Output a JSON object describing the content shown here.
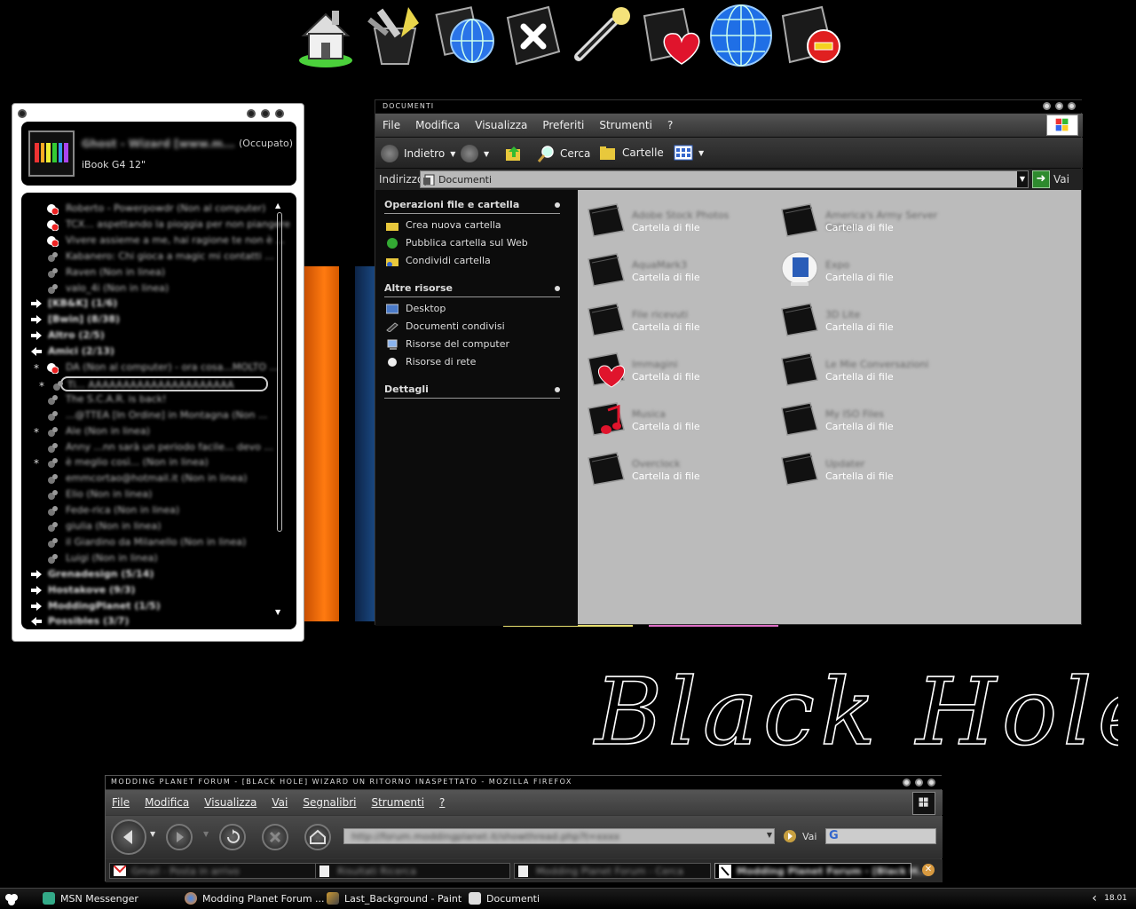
{
  "dock": {
    "icons": [
      "home-icon",
      "tools-icon",
      "web-tools-icon",
      "close-folder-icon",
      "pen-icon",
      "favorites-folder-icon",
      "globe-icon",
      "remove-folder-icon"
    ]
  },
  "wallpaper": {
    "text": "Black Hole"
  },
  "msn": {
    "display_name": "Ghost - Wizard [www.m...",
    "status": "(Occupato)",
    "personal_message": "iBook G4 12\"",
    "contacts": [
      {
        "text": "Roberto - Powerpowdr (Non al computer)",
        "icon": "busy",
        "indent": 1
      },
      {
        "text": "TCX... aspettando la pioggia per non piangere",
        "icon": "busy",
        "indent": 1
      },
      {
        "text": "Vivere assieme a me, hai ragione te non è ...",
        "icon": "busy",
        "indent": 1
      },
      {
        "text": "Kabanero: Chi gioca a magic mi contatti ...",
        "icon": "offline",
        "indent": 1
      },
      {
        "text": "Raven (Non in linea)",
        "icon": "offline",
        "indent": 1
      },
      {
        "text": "valo_4i (Non in linea)",
        "icon": "offline",
        "indent": 1
      },
      {
        "text": "[KB&K] (1/6)",
        "icon": "arrow-right",
        "indent": 0,
        "group": true
      },
      {
        "text": "[Bwin] (8/38)",
        "icon": "arrow-right",
        "indent": 0,
        "group": true
      },
      {
        "text": "Altro (2/5)",
        "icon": "arrow-right",
        "indent": 0,
        "group": true
      },
      {
        "text": "Amici (2/13)",
        "icon": "arrow-left",
        "indent": 0,
        "group": true
      },
      {
        "text": "DA (Non al computer) - ora cosa...MOLTO ...",
        "icon": "busy",
        "indent": 1,
        "star": true
      },
      {
        "text": "Ti... AAAAAAAAAAAAAAAAAAAAA",
        "icon": "offline",
        "indent": 1,
        "star": true,
        "selected": true
      },
      {
        "text": "The S.C.A.R. is back!",
        "icon": "offline",
        "indent": 1
      },
      {
        "text": "...@TTEA [In Ordine] in Montagna (Non ...",
        "icon": "offline",
        "indent": 1
      },
      {
        "text": "Ale (Non in linea)",
        "icon": "offline",
        "indent": 1,
        "star": true
      },
      {
        "text": "Anny ...nn sarà un periodo facile... devo ...",
        "icon": "offline",
        "indent": 1
      },
      {
        "text": "è meglio così... (Non in linea)",
        "icon": "offline",
        "indent": 1,
        "star": true
      },
      {
        "text": "emmcortao@hotmail.it (Non in linea)",
        "icon": "offline",
        "indent": 1
      },
      {
        "text": "Elio (Non in linea)",
        "icon": "offline",
        "indent": 1
      },
      {
        "text": "Fede-rica (Non in linea)",
        "icon": "offline",
        "indent": 1
      },
      {
        "text": "giulia (Non in linea)",
        "icon": "offline",
        "indent": 1
      },
      {
        "text": "il Giardino da Milanello (Non in linea)",
        "icon": "offline",
        "indent": 1
      },
      {
        "text": "Luigi (Non in linea)",
        "icon": "offline",
        "indent": 1
      },
      {
        "text": "Grenadesign (5/14)",
        "icon": "arrow-right",
        "indent": 0,
        "group": true
      },
      {
        "text": "Hostakove (9/3)",
        "icon": "arrow-right",
        "indent": 0,
        "group": true
      },
      {
        "text": "ModdingPlanet (1/5)",
        "icon": "arrow-right",
        "indent": 0,
        "group": true
      },
      {
        "text": "Possibles (3/7)",
        "icon": "arrow-left",
        "indent": 0,
        "group": true
      }
    ]
  },
  "explorer": {
    "title": "Documenti",
    "menu": [
      "File",
      "Modifica",
      "Visualizza",
      "Preferiti",
      "Strumenti",
      "?"
    ],
    "toolbar": {
      "back": "Indietro",
      "search": "Cerca",
      "folders": "Cartelle"
    },
    "address": {
      "label": "Indirizzo",
      "value": "Documenti",
      "go": "Vai"
    },
    "sidebar": {
      "tasks_title": "Operazioni file e cartella",
      "tasks": [
        "Crea nuova cartella",
        "Pubblica cartella sul Web",
        "Condividi cartella"
      ],
      "places_title": "Altre risorse",
      "places": [
        "Desktop",
        "Documenti condivisi",
        "Risorse del computer",
        "Risorse di rete"
      ],
      "details_title": "Dettagli"
    },
    "files": [
      {
        "name": "Adobe Stock Photos",
        "type": "Cartella di file",
        "icon": "folder"
      },
      {
        "name": "America's Army Server Setups",
        "type": "Cartella di file",
        "icon": "folder"
      },
      {
        "name": "AquaMark3",
        "type": "Cartella di file",
        "icon": "folder"
      },
      {
        "name": "Expo",
        "type": "Cartella di file",
        "icon": "imac"
      },
      {
        "name": "File ricevuti",
        "type": "Cartella di file",
        "icon": "folder"
      },
      {
        "name": "3D Lite",
        "type": "Cartella di file",
        "icon": "folder"
      },
      {
        "name": "Immagini",
        "type": "Cartella di file",
        "icon": "heart"
      },
      {
        "name": "Le Mie Conversazioni",
        "type": "Cartella di file",
        "icon": "folder"
      },
      {
        "name": "Musica",
        "type": "Cartella di file",
        "icon": "music"
      },
      {
        "name": "My ISO Files",
        "type": "Cartella di file",
        "icon": "folder"
      },
      {
        "name": "Overclock",
        "type": "Cartella di file",
        "icon": "folder"
      },
      {
        "name": "Updater",
        "type": "Cartella di file",
        "icon": "folder"
      }
    ]
  },
  "firefox": {
    "title": "Modding Planet Forum - [Black Hole] Wizard Un Ritorno Inaspettato - Mozilla Firefox",
    "menu": [
      "File",
      "Modifica",
      "Visualizza",
      "Vai",
      "Segnalibri",
      "Strumenti",
      "?"
    ],
    "url": "http://forum.moddingplanet.it/showthread.php?t=xxxx",
    "go": "Vai",
    "tabs": [
      "Gmail - Posta in arrivo",
      "Risultati Ricerca",
      "Modding Planet Forum - Cerca",
      "Modding Planet Forum - [Black H..."
    ]
  },
  "taskbar": {
    "items": [
      "MSN Messenger",
      "Modding Planet Forum ...",
      "Last_Background - Paint",
      "Documenti"
    ],
    "clock": "18.01"
  }
}
